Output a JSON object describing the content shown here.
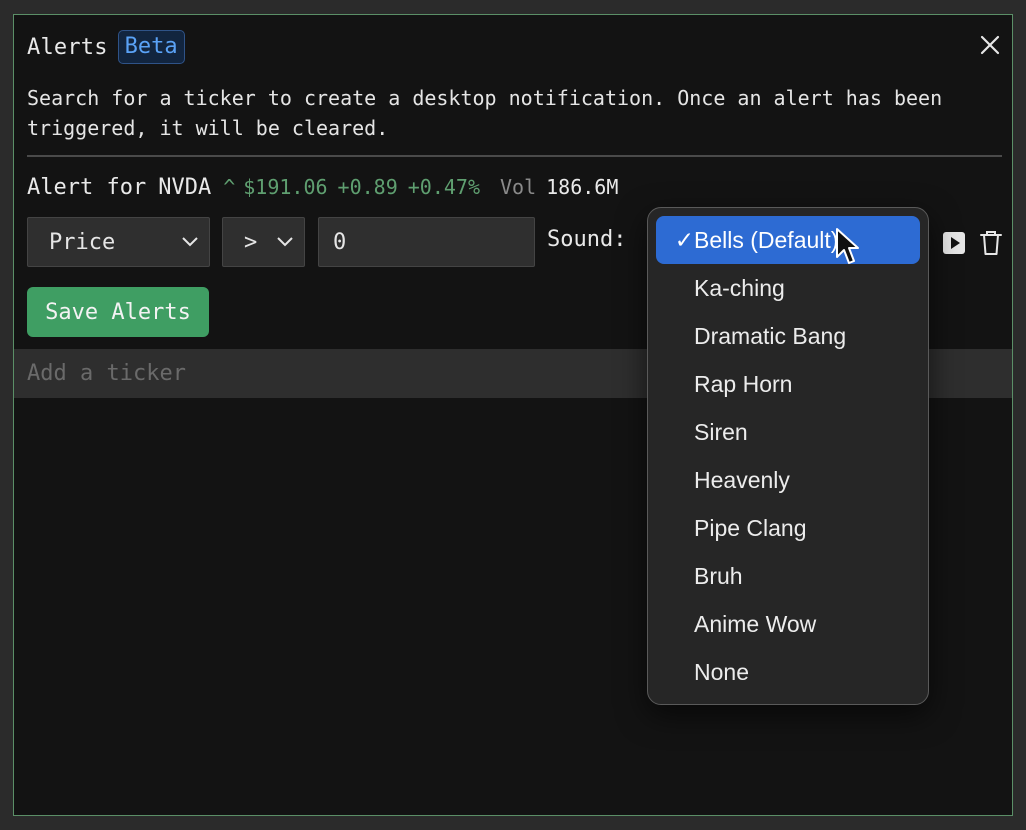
{
  "header": {
    "title": "Alerts",
    "badge": "Beta"
  },
  "description": "Search for a ticker to create a desktop notification. Once an alert has been triggered, it will be cleared.",
  "alert": {
    "label": "Alert for",
    "ticker": "NVDA",
    "direction_glyph": "^",
    "price": "$191.06",
    "change": "+0.89",
    "change_pct": "+0.47%",
    "volume_label": "Vol",
    "volume": "186.6M",
    "up_color": "#5f9f70"
  },
  "controls": {
    "field_select": "Price",
    "operator_select": ">",
    "value_input": "0",
    "sound_label": "Sound:",
    "play_icon": "play-icon",
    "delete_icon": "trash-icon"
  },
  "save_button": "Save Alerts",
  "search": {
    "placeholder": "Add a ticker"
  },
  "sound_menu": {
    "selected_index": 0,
    "check_glyph": "✓",
    "options": [
      "Bells (Default)",
      "Ka-ching",
      "Dramatic Bang",
      "Rap Horn",
      "Siren",
      "Heavenly",
      "Pipe Clang",
      "Bruh",
      "Anime Wow",
      "None"
    ]
  },
  "colors": {
    "accent_green": "#3f9e63",
    "menu_highlight": "#2d6bd3",
    "beta_text": "#5aa2f6",
    "panel_border": "#5b8f67"
  }
}
